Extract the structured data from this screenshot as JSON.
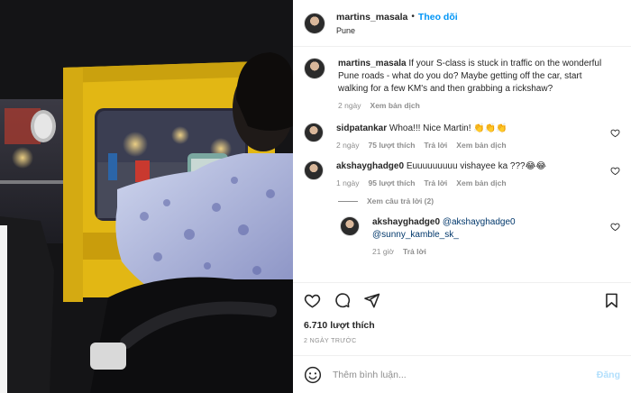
{
  "header": {
    "username": "martins_masala",
    "separator": "•",
    "follow_label": "Theo dõi",
    "location": "Pune"
  },
  "caption": {
    "username": "martins_masala",
    "text": "If your S-class is stuck in traffic on the wonderful Pune roads - what do you do? Maybe getting off the car, start walking for a few KM's and then grabbing a rickshaw?",
    "time": "2 ngày",
    "translate": "Xem bản dịch"
  },
  "comments": [
    {
      "username": "sidpatankar",
      "text": "Whoa!!! Nice Martin! 👏👏👏",
      "time": "2 ngày",
      "likes": "75 lượt thích",
      "reply": "Trả lời",
      "translate": "Xem bản dịch"
    },
    {
      "username": "akshayghadge0",
      "text": "Euuuuuuuuu vishayee ka ???😂😂",
      "time": "1 ngày",
      "likes": "95 lượt thích",
      "reply": "Trả lời",
      "translate": "Xem bản dịch"
    }
  ],
  "view_replies_label": "Xem câu trả lời (2)",
  "reply": {
    "username": "akshayghadge0",
    "mention1": "@akshayghadge0",
    "mention2": "@sunny_kamble_sk_",
    "time": "21 giờ",
    "reply": "Trả lời"
  },
  "likes_count": "6.710 lượt thích",
  "time_ago": "2 NGÀY TRƯỚC",
  "add_comment": {
    "placeholder": "Thêm bình luận...",
    "post_label": "Đăng"
  }
}
